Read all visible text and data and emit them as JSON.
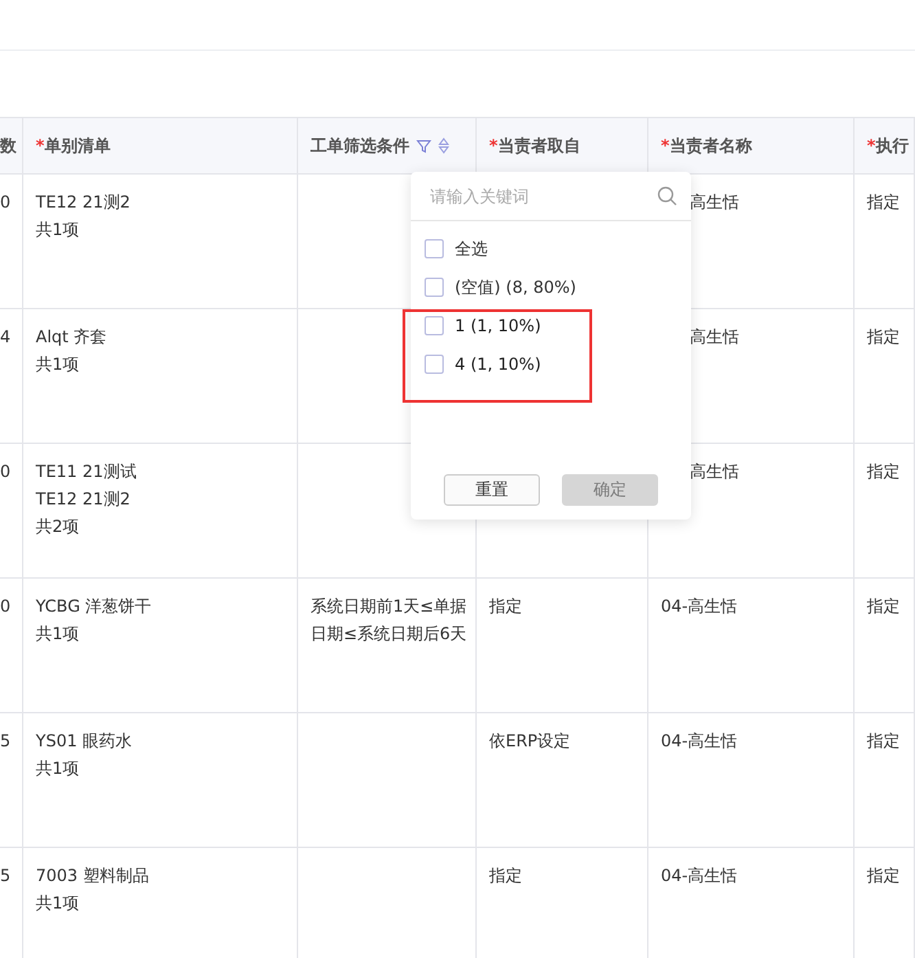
{
  "table": {
    "columns": [
      {
        "kind": "plain",
        "label": "数"
      },
      {
        "kind": "plain",
        "required_mark": "*",
        "label": "单别清单"
      },
      {
        "kind": "filterable",
        "label": "工单筛选条件"
      },
      {
        "kind": "plain",
        "required_mark": "*",
        "label": "当责者取自"
      },
      {
        "kind": "plain",
        "required_mark": "*",
        "label": "当责者名称"
      },
      {
        "kind": "plain",
        "required_mark": "*",
        "label": "执行"
      }
    ],
    "rows": [
      {
        "cells": [
          {
            "lines": [
              "0"
            ]
          },
          {
            "lines": [
              "TE12 21测2",
              "共1项"
            ]
          },
          {},
          {},
          {
            "lines": [
              "高生恬"
            ],
            "behind_popup": true
          },
          {
            "lines": [
              "指定"
            ]
          }
        ]
      },
      {
        "cells": [
          {
            "lines": [
              "4"
            ]
          },
          {
            "lines": [
              "Alqt 齐套",
              "共1项"
            ]
          },
          {},
          {},
          {
            "lines": [
              "高生恬"
            ],
            "behind_popup": true
          },
          {
            "lines": [
              "指定"
            ]
          }
        ]
      },
      {
        "cells": [
          {
            "lines": [
              "0"
            ]
          },
          {
            "lines": [
              "TE11 21测试",
              "TE12 21测2",
              "共2项"
            ]
          },
          {},
          {},
          {
            "lines": [
              "高生恬"
            ],
            "behind_popup": true
          },
          {
            "lines": [
              "指定"
            ]
          }
        ]
      },
      {
        "cells": [
          {
            "lines": [
              "0"
            ]
          },
          {
            "lines": [
              "YCBG 洋葱饼干",
              "共1项"
            ]
          },
          {
            "lines": [
              "系统日期前1天≤单据日期≤系统日期后6天"
            ]
          },
          {
            "lines": [
              "指定"
            ]
          },
          {
            "lines": [
              "04-高生恬"
            ]
          },
          {
            "lines": [
              "指定"
            ]
          }
        ]
      },
      {
        "cells": [
          {
            "lines": [
              "5"
            ]
          },
          {
            "lines": [
              "YS01 眼药水",
              "共1项"
            ]
          },
          {},
          {
            "lines": [
              "依ERP设定"
            ]
          },
          {
            "lines": [
              "04-高生恬"
            ]
          },
          {
            "lines": [
              "指定"
            ]
          }
        ]
      },
      {
        "cells": [
          {
            "lines": [
              "5"
            ]
          },
          {
            "lines": [
              "7003 塑料制品",
              "共1项"
            ]
          },
          {},
          {
            "lines": [
              "指定"
            ]
          },
          {
            "lines": [
              "04-高生恬"
            ]
          },
          {
            "lines": [
              "指定"
            ]
          }
        ]
      }
    ]
  },
  "filter_popup": {
    "search": {
      "placeholder": "请输入关键词"
    },
    "options": [
      {
        "label": "全选",
        "checked": false,
        "highlighted": false
      },
      {
        "label": "(空值) (8, 80%)",
        "checked": false,
        "highlighted": false
      },
      {
        "label": "1 (1, 10%)",
        "checked": false,
        "highlighted": true
      },
      {
        "label": "4 (1, 10%)",
        "checked": false,
        "highlighted": true
      }
    ],
    "buttons": [
      {
        "label": "重置",
        "disabled": false
      },
      {
        "label": "确定",
        "disabled": true
      }
    ]
  }
}
